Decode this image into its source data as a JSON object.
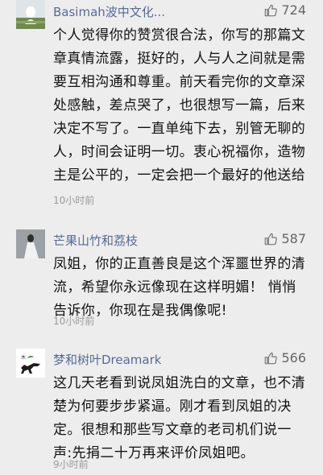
{
  "comments": [
    {
      "username": "Basimah波中文化...",
      "likes": "724",
      "text": "个人觉得你的赞赏很合法，你写的那篇文章真情流露，挺好的，人与人之间就是需要互相沟通和尊重。前天看完你的文章深处感触，差点哭了，也很想写一篇，后来决定不写了。一直单纯下去，别管无聊的人，时间会证明一切。衷心祝福你，造物主是公平的，一定会把一个最好的他送给你。愿造物主慈爱你。",
      "time": "10小时前"
    },
    {
      "username": "芒果山竹和荔枝",
      "likes": "587",
      "text": "凤姐，你的正直善良是这个浑噩世界的清流，希望你永远像现在这样明媚！ 悄悄告诉你，你现在是我偶像呢!",
      "time": "10小时前"
    },
    {
      "username": "梦和树叶Dreamark",
      "likes": "566",
      "text": "这几天老看到说凤姐洗白的文章，也不清楚为何要步步紧逼。刚才看到凤姐的决定。很想和那些写文章的老司机们说一声:先捐二十万再来评价凤姐吧。",
      "time": "9小时前"
    }
  ],
  "icons": {
    "like": "thumbs-up-icon"
  },
  "colors": {
    "username": "#576b95",
    "background": "#ededed",
    "meta": "#9a9a9a"
  }
}
